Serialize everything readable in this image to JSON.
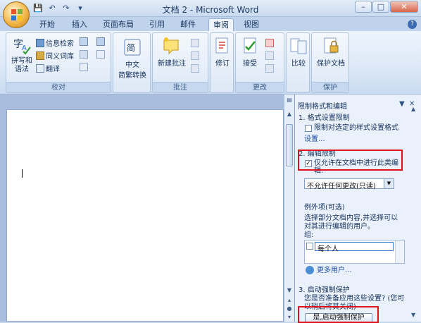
{
  "window": {
    "title": "文档 2 - Microsoft Word",
    "buttons": {
      "minimize": "–",
      "maximize": "□",
      "close": "✕"
    }
  },
  "qat": {
    "save": "💾",
    "undo": "↶",
    "redo": "↷",
    "customize": "▾"
  },
  "tabs": [
    {
      "label": "开始"
    },
    {
      "label": "插入"
    },
    {
      "label": "页面布局"
    },
    {
      "label": "引用"
    },
    {
      "label": "邮件"
    },
    {
      "label": "审阅"
    },
    {
      "label": "视图"
    }
  ],
  "help": "?",
  "ribbon": {
    "proofing": {
      "label": "校对",
      "spell": "拼写和\n语法",
      "research": "信息检索",
      "thesaurus": "同义词库",
      "translate": "翻译"
    },
    "chinese": {
      "label_line1": "中文",
      "label_line2": "简繁转换"
    },
    "comments": {
      "label": "批注",
      "new": "新建批注"
    },
    "tracking": {
      "label": "修订",
      "track": "修订"
    },
    "changes": {
      "label": "更改",
      "accept": "接受"
    },
    "compare": {
      "label": "比较"
    },
    "protect": {
      "label": "保护",
      "doc": "保护文档"
    }
  },
  "pane": {
    "title": "限制格式和编辑",
    "sec1": "1. 格式设置限制",
    "sec1_opt_line1": "限制对选定的样式设置格式",
    "sec1_link": "设置...",
    "sec2": "2. 编辑限制",
    "sec2_opt_line1": "仅允许在文档中进行此类编",
    "sec2_opt_line2": "辑:",
    "sec2_select": "不允许任何更改(只读)",
    "exceptions": "例外项(可选)",
    "exc_line1": "选择部分文档内容,并选择可以",
    "exc_line2": "对其进行编辑的用户。",
    "group_label": "组:",
    "everyone": "每个人",
    "more_users": "更多用户...",
    "sec3": "3. 启动强制保护",
    "sec3_line1": "您是否准备应用这些设置? (您可",
    "sec3_line2": "以稍后将其关闭)",
    "start_button": "是,启动强制保护"
  },
  "colors": {
    "highlight_red": "#e0121e",
    "ribbon_bg": "#dce8f7"
  }
}
